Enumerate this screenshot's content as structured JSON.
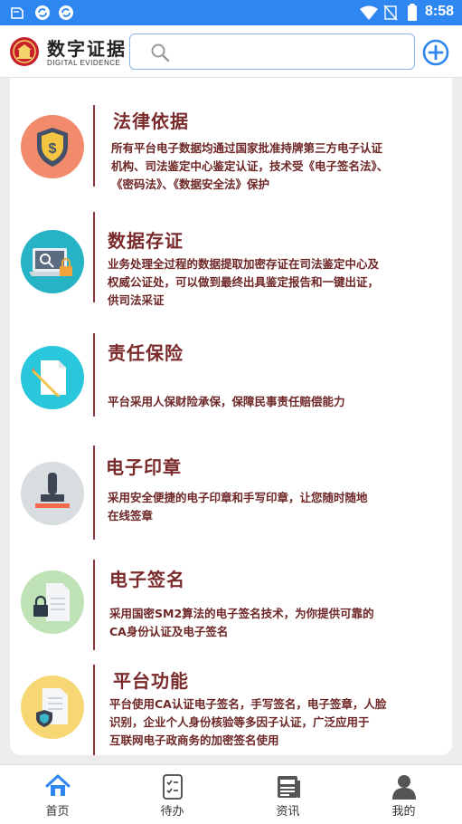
{
  "status_bar": {
    "time": "8:58"
  },
  "header": {
    "logo_title": "数字证据",
    "logo_subtitle": "DIGITAL EVIDENCE",
    "search_placeholder": ""
  },
  "features": [
    {
      "title": "法律依据",
      "lines": [
        "所有平台电子数据均通过国家批准持牌第三方电子认证",
        "机构、司法鉴定中心鉴定认证，技术受《电子签名法》、",
        "《密码法》、《数据安全法》保护"
      ],
      "icon": "shield-dollar-icon",
      "color": "#f28a6c"
    },
    {
      "title": "数据存证",
      "lines": [
        "业务处理全过程的数据提取加密存证在司法鉴定中心及",
        "权威公证处，可以做到最终出具鉴定报告和一键出证，",
        "供司法采证"
      ],
      "icon": "laptop-lock-icon",
      "color": "#27b3c6"
    },
    {
      "title": "责任保险",
      "lines": [
        "平台采用人保财险承保，保障民事责任赔偿能力"
      ],
      "icon": "document-pen-icon",
      "color": "#28c7dc"
    },
    {
      "title": "电子印章",
      "lines": [
        "采用安全便捷的电子印章和手写印章，让您随时随地",
        "在线签章"
      ],
      "icon": "stamp-icon",
      "color": "#d8dde0"
    },
    {
      "title": "电子签名",
      "lines": [
        "采用国密SM2算法的电子签名技术，为你提供可靠的",
        "CA身份认证及电子签名"
      ],
      "icon": "document-lock-icon",
      "color": "#bfe3b6"
    },
    {
      "title": "平台功能",
      "lines": [
        "平台使用CA认证电子签名，手写签名，电子签章，人脸",
        "识别，企业个人身份核验等多因子认证，广泛应用于",
        "互联网电子政商务的加密签名使用"
      ],
      "icon": "certificate-shield-icon",
      "color": "#f7d774"
    }
  ],
  "bottom_nav": [
    {
      "label": "首页",
      "icon": "home-icon",
      "active": true
    },
    {
      "label": "待办",
      "icon": "checklist-icon",
      "active": false
    },
    {
      "label": "资讯",
      "icon": "news-icon",
      "active": false
    },
    {
      "label": "我的",
      "icon": "user-icon",
      "active": false
    }
  ],
  "colors": {
    "status_bar": "#2e86f0",
    "accent": "#2e86f0",
    "title_text": "#7a2a2a",
    "divider": "#8a3a3a"
  }
}
